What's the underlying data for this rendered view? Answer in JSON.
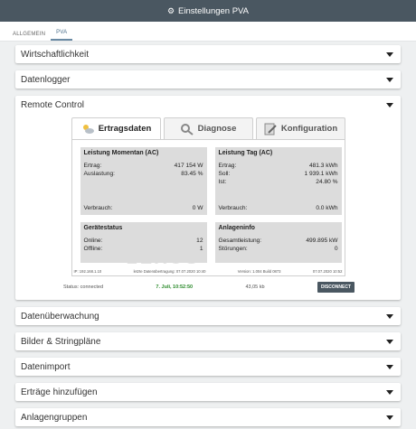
{
  "header": {
    "title": "Einstellungen PVA",
    "icon": "gear-icon"
  },
  "tabs": [
    {
      "label": "ALLGEMEIN"
    },
    {
      "label": "PVA"
    }
  ],
  "sections": [
    {
      "label": "Wirtschaftlichkeit"
    },
    {
      "label": "Datenlogger"
    },
    {
      "label": "Remote Control"
    },
    {
      "label": "Datenüberwachung"
    },
    {
      "label": "Bilder & Stringpläne"
    },
    {
      "label": "Datenimport"
    },
    {
      "label": "Erträge hinzufügen"
    },
    {
      "label": "Anlagengruppen"
    }
  ],
  "remote": {
    "tabs": [
      {
        "label": "Ertragsdaten",
        "icon": "weather-sun-cloud-icon"
      },
      {
        "label": "Diagnose",
        "icon": "magnifier-icon"
      },
      {
        "label": "Konfiguration",
        "icon": "clipboard-edit-icon"
      }
    ],
    "leistung_momentan": {
      "title": "Leistung Momentan (AC)",
      "ertrag_label": "Ertrag:",
      "ertrag_value": "417 154 W",
      "auslastung_label": "Auslastung:",
      "auslastung_value": "83.45 %",
      "verbrauch_label": "Verbrauch:",
      "verbrauch_value": "0 W"
    },
    "leistung_tag": {
      "title": "Leistung Tag (AC)",
      "ertrag_label": "Ertrag:",
      "ertrag_value": "481.3 kWh",
      "soll_label": "Soll:",
      "soll_value": "1 939.1 kWh",
      "ist_label": "Ist:",
      "ist_value": "24.80 %",
      "verbrauch_label": "Verbrauch:",
      "verbrauch_value": "0.0 kWh"
    },
    "geraetestatus": {
      "title": "Gerätestatus",
      "online_label": "Online:",
      "online_value": "12",
      "offline_label": "Offline:",
      "offline_value": "1"
    },
    "anlageninfo": {
      "title": "Anlageninfo",
      "gesamt_label": "Gesamtleistung:",
      "gesamt_value": "499.895 kW",
      "stoerungen_label": "Störungen:",
      "stoerungen_value": "0"
    },
    "footer": {
      "ip": "IP: 192.168.1.10",
      "last_transfer": "letzte Datenübertragung: 07.07.2020 10:40",
      "version": "Version: 1.004 Build 0873",
      "date": "07.07.2020 10:52"
    },
    "watermark": "LEXUS"
  },
  "status": {
    "status_text": "Status: connected",
    "time": "7. Juli, 10:52:50",
    "size": "43,05 kb",
    "disconnect_label": "DISCONNECT"
  }
}
